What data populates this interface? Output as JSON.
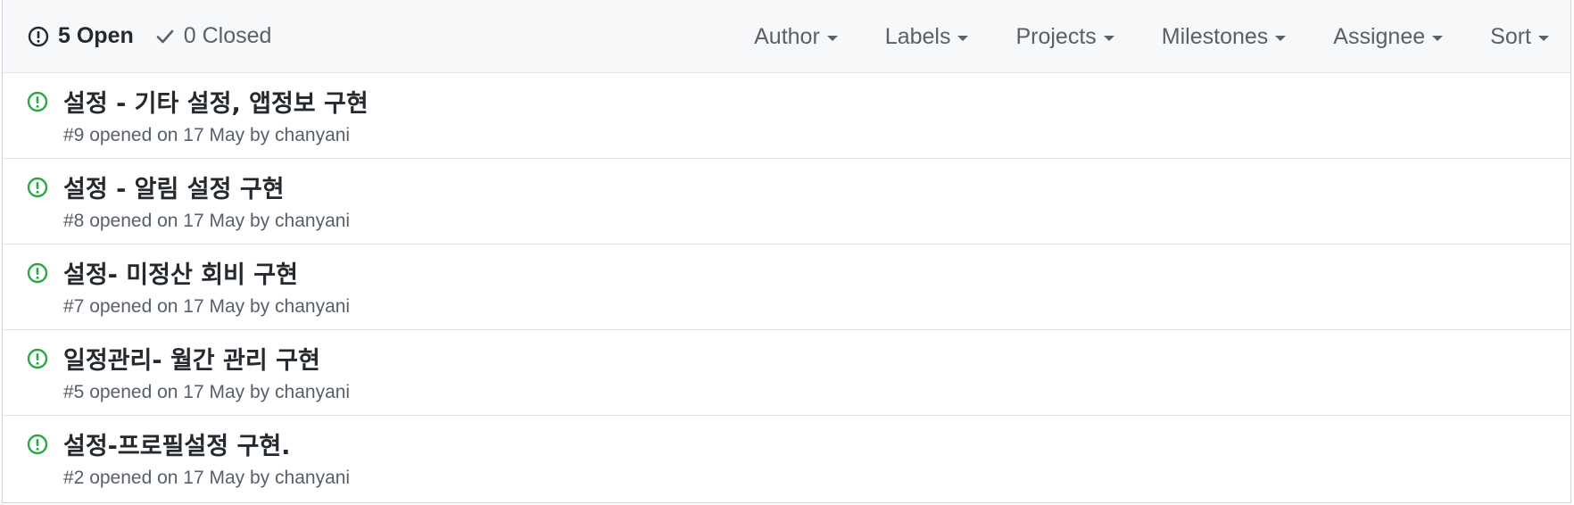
{
  "header": {
    "open_label": "5 Open",
    "closed_label": "0 Closed",
    "filters": [
      {
        "label": "Author"
      },
      {
        "label": "Labels"
      },
      {
        "label": "Projects"
      },
      {
        "label": "Milestones"
      },
      {
        "label": "Assignee"
      },
      {
        "label": "Sort"
      }
    ]
  },
  "colors": {
    "open_issue": "#28a745",
    "text_primary": "#24292e",
    "text_muted": "#586069",
    "header_bg": "#f6f8fa"
  },
  "issues": [
    {
      "title": "설정 - 기타 설정, 앱정보 구현",
      "number": "#9",
      "opened_text": "opened on 17 May by",
      "author": "chanyani"
    },
    {
      "title": "설정 - 알림 설정 구현",
      "number": "#8",
      "opened_text": "opened on 17 May by",
      "author": "chanyani"
    },
    {
      "title": "설정- 미정산 회비 구현",
      "number": "#7",
      "opened_text": "opened on 17 May by",
      "author": "chanyani"
    },
    {
      "title": "일정관리- 월간 관리 구현",
      "number": "#5",
      "opened_text": "opened on 17 May by",
      "author": "chanyani"
    },
    {
      "title": "설정-프로필설정 구현.",
      "number": "#2",
      "opened_text": "opened on 17 May by",
      "author": "chanyani"
    }
  ]
}
